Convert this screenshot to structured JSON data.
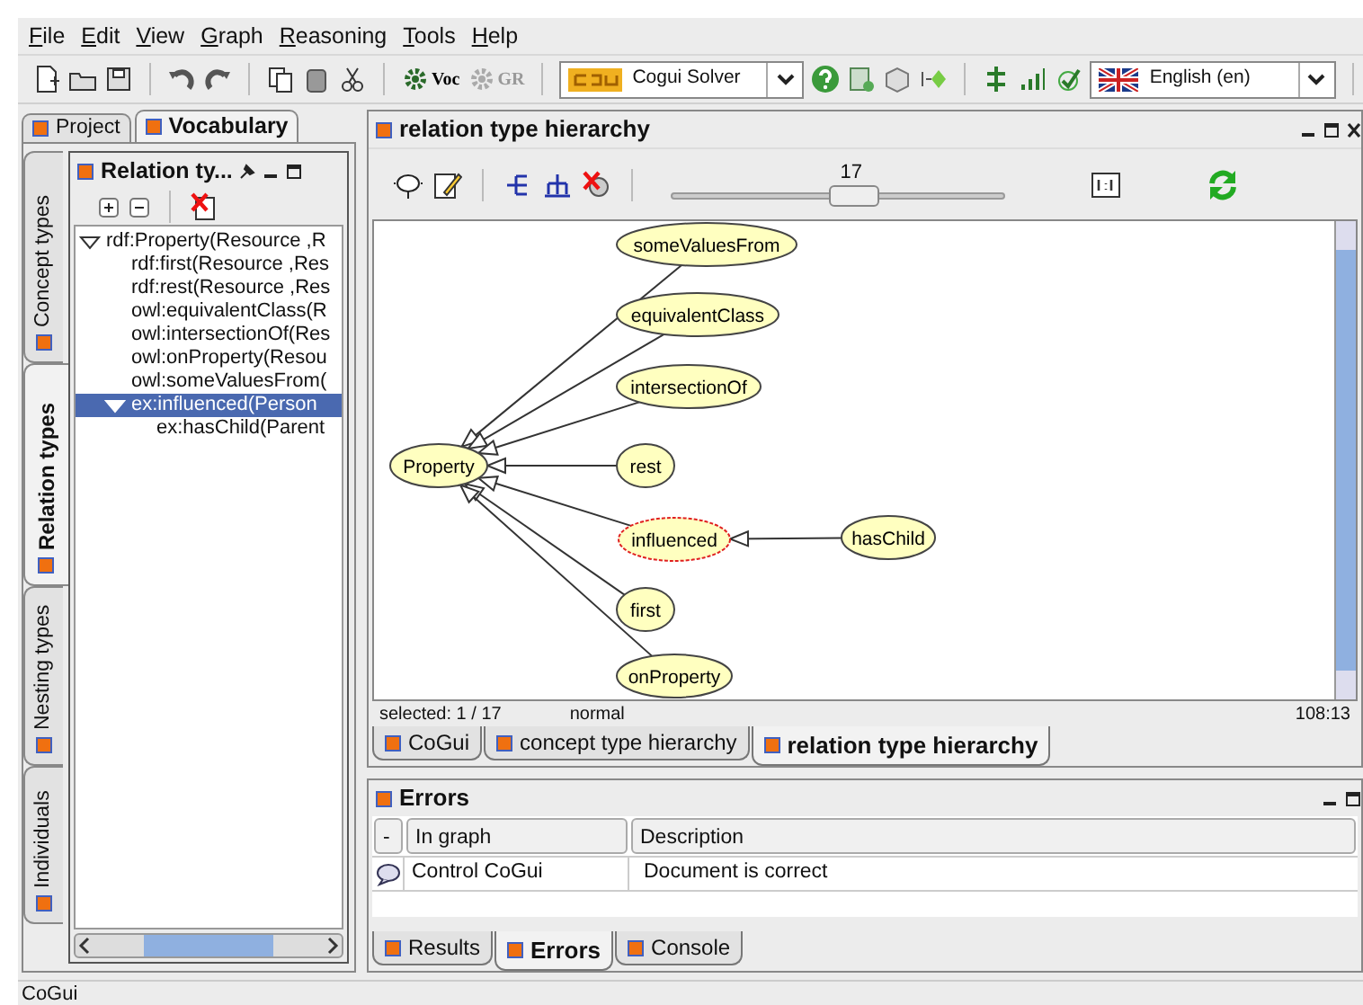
{
  "menu": [
    {
      "label": "File"
    },
    {
      "label": "Edit"
    },
    {
      "label": "View"
    },
    {
      "label": "Graph"
    },
    {
      "label": "Reasoning"
    },
    {
      "label": "Tools"
    },
    {
      "label": "Help"
    }
  ],
  "toolbar": {
    "voc_label": "Voc",
    "gr_label": "GR",
    "gr_disabled": true,
    "solver": "Cogui Solver",
    "language": "English (en)"
  },
  "left_tabs": [
    {
      "label": "Project",
      "selected": false
    },
    {
      "label": "Vocabulary",
      "selected": true
    }
  ],
  "vertical_tabs": [
    {
      "label": "Concept types",
      "selected": false
    },
    {
      "label": "Relation types",
      "selected": true
    },
    {
      "label": "Nesting types",
      "selected": false
    },
    {
      "label": "Individuals",
      "selected": false
    }
  ],
  "relation_panel": {
    "title": "Relation ty...",
    "tree": [
      {
        "label": "rdf:Property(Resource ,R",
        "expanded": true,
        "selected": false,
        "children": [
          {
            "label": "rdf:first(Resource ,Res",
            "selected": false
          },
          {
            "label": "rdf:rest(Resource ,Res",
            "selected": false
          },
          {
            "label": "owl:equivalentClass(R",
            "selected": false
          },
          {
            "label": "owl:intersectionOf(Res",
            "selected": false
          },
          {
            "label": "owl:onProperty(Resou",
            "selected": false
          },
          {
            "label": "owl:someValuesFrom(",
            "selected": false
          },
          {
            "label": "ex:influenced(Person",
            "expanded": true,
            "selected": true,
            "children": [
              {
                "label": "ex:hasChild(Parent",
                "selected": false
              }
            ]
          }
        ]
      }
    ]
  },
  "editor": {
    "title": "relation type hierarchy",
    "zoom": {
      "reading": "17",
      "level": 0.55
    },
    "graph": {
      "nodes": [
        {
          "label": "Property",
          "selected": false
        },
        {
          "label": "someValuesFrom",
          "selected": false
        },
        {
          "label": "equivalentClass",
          "selected": false
        },
        {
          "label": "intersectionOf",
          "selected": false
        },
        {
          "label": "rest",
          "selected": false
        },
        {
          "label": "influenced",
          "selected": true
        },
        {
          "label": "first",
          "selected": false
        },
        {
          "label": "onProperty",
          "selected": false
        },
        {
          "label": "hasChild",
          "selected": false
        }
      ]
    },
    "status": {
      "selected": "selected: 1 / 17",
      "mode": "normal",
      "position": "108:13"
    }
  },
  "editor_tabs": [
    {
      "label": "CoGui",
      "selected": false
    },
    {
      "label": "concept type hierarchy",
      "selected": false
    },
    {
      "label": "relation type hierarchy",
      "selected": true
    }
  ],
  "errors": {
    "title": "Errors",
    "columns": [
      "-",
      "In graph",
      "Description"
    ],
    "rows": [
      {
        "cells": [
          "",
          "Control CoGui",
          "Document is correct"
        ]
      }
    ]
  },
  "bottom_tabs": [
    {
      "label": "Results",
      "selected": false
    },
    {
      "label": "Errors",
      "selected": true
    },
    {
      "label": "Console",
      "selected": false
    }
  ],
  "status_bar": "CoGui"
}
